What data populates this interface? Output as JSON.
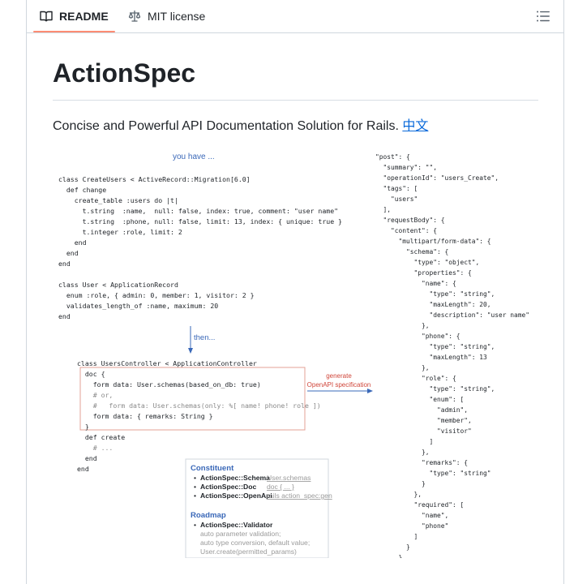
{
  "tabs": {
    "readme": "README",
    "license": "MIT license"
  },
  "readme": {
    "title": "ActionSpec",
    "description": "Concise and Powerful API Documentation Solution for Rails.",
    "lang_link": "中文"
  },
  "diagram": {
    "you_have": "you have ...",
    "then": "then...",
    "generate": "generate",
    "openapi_spec": "OpenAPI specification",
    "migration_lines": [
      "class CreateUsers < ActiveRecord::Migration[6.0]",
      "  def change",
      "    create_table :users do |t|",
      "      t.string  :name,  null: false, index: true, comment: \"user name\"",
      "      t.string  :phone, null: false, limit: 13, index: { unique: true }",
      "      t.integer :role, limit: 2",
      "    end",
      "  end",
      "end"
    ],
    "model_lines": [
      "class User < ApplicationRecord",
      "  enum :role, { admin: 0, member: 1, visitor: 2 }",
      "  validates_length_of :name, maximum: 20",
      "end"
    ],
    "controller_lines": [
      "class UsersController < ApplicationController",
      "  doc {",
      "    form data: User.schemas(based_on_db: true)",
      "    # or,",
      "    #   form data: User.schemas(only: %[ name! phone! role ])",
      "    form data: { remarks: String }",
      "  }",
      "  def create",
      "    # ...",
      "  end",
      "end"
    ],
    "json_lines": [
      "\"post\": {",
      "  \"summary\": \"\",",
      "  \"operationId\": \"users_Create\",",
      "  \"tags\": [",
      "    \"users\"",
      "  ],",
      "  \"requestBody\": {",
      "    \"content\": {",
      "      \"multipart/form-data\": {",
      "        \"schema\": {",
      "          \"type\": \"object\",",
      "          \"properties\": {",
      "            \"name\": {",
      "              \"type\": \"string\",",
      "              \"maxLength\": 20,",
      "              \"description\": \"user name\"",
      "            },",
      "            \"phone\": {",
      "              \"type\": \"string\",",
      "              \"maxLength\": 13",
      "            },",
      "            \"role\": {",
      "              \"type\": \"string\",",
      "              \"enum\": [",
      "                \"admin\",",
      "                \"member\",",
      "                \"visitor\"",
      "              ]",
      "            },",
      "            \"remarks\": {",
      "              \"type\": \"string\"",
      "            }",
      "          },",
      "          \"required\": [",
      "            \"name\",",
      "            \"phone\"",
      "          ]",
      "        }",
      "      }"
    ],
    "constituent": {
      "title": "Constituent",
      "items": [
        {
          "name": "ActionSpec::Schema",
          "note": "User.schemas"
        },
        {
          "name": "ActionSpec::Doc",
          "note": "doc { ... }"
        },
        {
          "name": "ActionSpec::OpenApi",
          "note": "rails action_spec:gen"
        }
      ]
    },
    "roadmap": {
      "title": "Roadmap",
      "item": "ActionSpec::Validator",
      "notes": [
        "auto parameter validation;",
        "auto type conversion, default value;",
        "User.create(permitted_params)"
      ]
    }
  }
}
